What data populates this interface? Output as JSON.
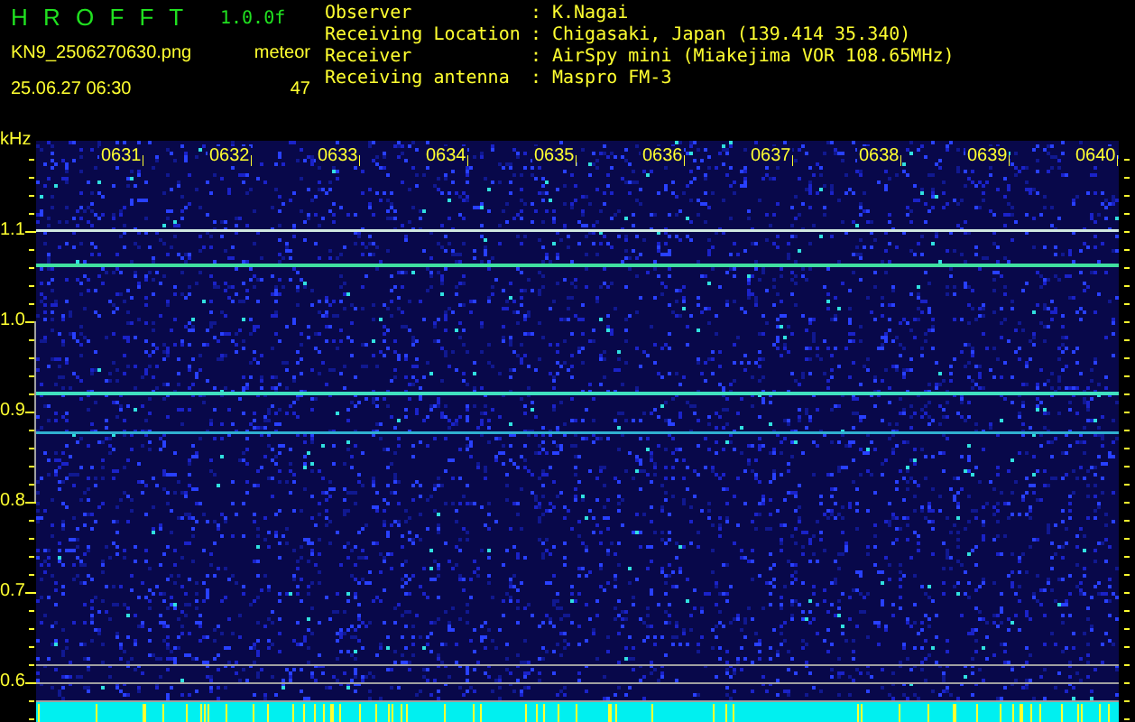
{
  "header": {
    "title": "H R O F F T",
    "version": "1.0.0f",
    "filename": "KN9_2506270630.png",
    "datetime": "25.06.27 06:30",
    "count_label": "meteor",
    "count": "47"
  },
  "info": [
    {
      "label": "Observer",
      "value": "K.Nagai"
    },
    {
      "label": "Receiving Location",
      "value": "Chigasaki, Japan (139.414 35.340)"
    },
    {
      "label": "Receiver",
      "value": "AirSpy mini (Miakejima VOR 108.65MHz)"
    },
    {
      "label": "Receiving antenna",
      "value": "Maspro FM-3"
    }
  ],
  "separator": ":",
  "y_axis": {
    "unit": "kHz",
    "labels": [
      "1.1",
      "1.0",
      "0.9",
      "0.8",
      "0.7",
      "0.6"
    ]
  },
  "time_labels": [
    "0631",
    "0632",
    "0633",
    "0634",
    "0635",
    "0636",
    "0637",
    "0638",
    "0639",
    "0640"
  ]
}
